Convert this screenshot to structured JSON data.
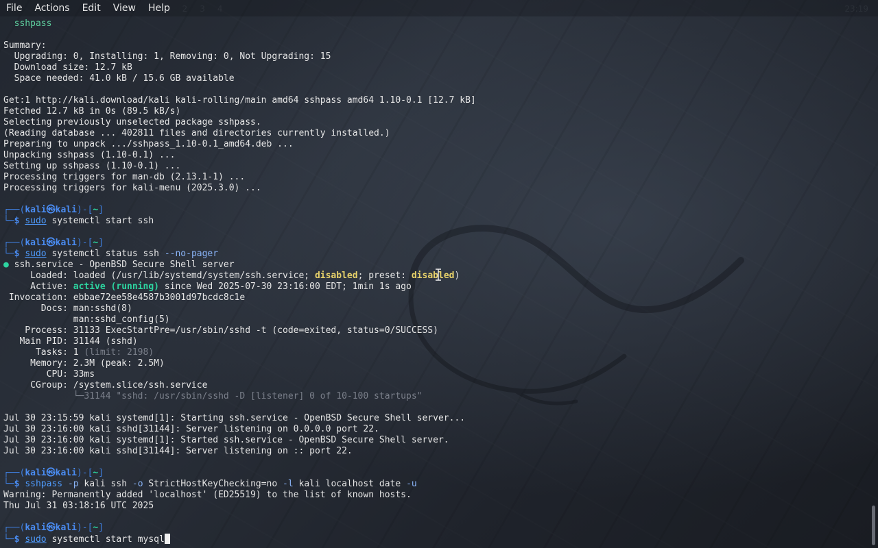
{
  "menubar": {
    "items": [
      "File",
      "Actions",
      "Edit",
      "View",
      "Help"
    ]
  },
  "ghost_panel": {
    "workspaces": [
      "1",
      "2",
      "3",
      "4"
    ],
    "clock": "23:19"
  },
  "terminal": {
    "lines": [
      {
        "segs": [
          {
            "t": "  sshpass",
            "c": "c-green"
          }
        ]
      },
      {
        "segs": [
          {
            "t": ""
          }
        ]
      },
      {
        "segs": [
          {
            "t": "Summary:"
          }
        ]
      },
      {
        "segs": [
          {
            "t": "  Upgrading: 0, Installing: 1, Removing: 0, Not Upgrading: 15"
          }
        ]
      },
      {
        "segs": [
          {
            "t": "  Download size: 12.7 kB"
          }
        ]
      },
      {
        "segs": [
          {
            "t": "  Space needed: 41.0 kB / 15.6 GB available"
          }
        ]
      },
      {
        "segs": [
          {
            "t": ""
          }
        ]
      },
      {
        "segs": [
          {
            "t": "Get:1 http://kali.download/kali kali-rolling/main amd64 sshpass amd64 1.10-0.1 [12.7 kB]"
          }
        ]
      },
      {
        "segs": [
          {
            "t": "Fetched 12.7 kB in 0s (89.5 kB/s)"
          }
        ]
      },
      {
        "segs": [
          {
            "t": "Selecting previously unselected package sshpass."
          }
        ]
      },
      {
        "segs": [
          {
            "t": "(Reading database ... 402811 files and directories currently installed.)"
          }
        ]
      },
      {
        "segs": [
          {
            "t": "Preparing to unpack .../sshpass_1.10-0.1_amd64.deb ..."
          }
        ]
      },
      {
        "segs": [
          {
            "t": "Unpacking sshpass (1.10-0.1) ..."
          }
        ]
      },
      {
        "segs": [
          {
            "t": "Setting up sshpass (1.10-0.1) ..."
          }
        ]
      },
      {
        "segs": [
          {
            "t": "Processing triggers for man-db (2.13.1-1) ..."
          }
        ]
      },
      {
        "segs": [
          {
            "t": "Processing triggers for kali-menu (2025.3.0) ..."
          }
        ]
      },
      {
        "segs": [
          {
            "t": ""
          }
        ]
      },
      {
        "prompt": true,
        "segs": [
          {
            "t": "┌──(",
            "c": "c-blue"
          },
          {
            "t": "kali㉿kali",
            "c": "c-blue-b"
          },
          {
            "t": ")-[",
            "c": "c-blue"
          },
          {
            "t": "~",
            "c": "c-green-b"
          },
          {
            "t": "]",
            "c": "c-blue"
          }
        ]
      },
      {
        "cmd": true,
        "segs": [
          {
            "t": "└─",
            "c": "c-blue"
          },
          {
            "t": "$ ",
            "c": "c-blue-b"
          },
          {
            "t": "sudo",
            "c": "c-cmd-blue",
            "u": true
          },
          {
            "t": " systemctl start ssh"
          }
        ]
      },
      {
        "segs": [
          {
            "t": ""
          }
        ]
      },
      {
        "prompt": true,
        "segs": [
          {
            "t": "┌──(",
            "c": "c-blue"
          },
          {
            "t": "kali㉿kali",
            "c": "c-blue-b"
          },
          {
            "t": ")-[",
            "c": "c-blue"
          },
          {
            "t": "~",
            "c": "c-green-b"
          },
          {
            "t": "]",
            "c": "c-blue"
          }
        ]
      },
      {
        "cmd": true,
        "segs": [
          {
            "t": "└─",
            "c": "c-blue"
          },
          {
            "t": "$ ",
            "c": "c-blue-b"
          },
          {
            "t": "sudo",
            "c": "c-cmd-blue",
            "u": true
          },
          {
            "t": " systemctl status ssh "
          },
          {
            "t": "--no-pager",
            "c": "c-opt"
          }
        ]
      },
      {
        "segs": [
          {
            "t": "●",
            "c": "c-dot"
          },
          {
            "t": " ssh.service - OpenBSD Secure Shell server"
          }
        ]
      },
      {
        "segs": [
          {
            "t": "     Loaded: loaded (/usr/lib/systemd/system/ssh.service; "
          },
          {
            "t": "disabled",
            "c": "c-yellow-b"
          },
          {
            "t": "; preset: "
          },
          {
            "t": "disabled",
            "c": "c-yellow-b"
          },
          {
            "t": ")"
          }
        ]
      },
      {
        "segs": [
          {
            "t": "     Active: "
          },
          {
            "t": "active (running)",
            "c": "c-green-b"
          },
          {
            "t": " since Wed 2025-07-30 23:16:00 EDT; 1min 1s ago"
          }
        ]
      },
      {
        "segs": [
          {
            "t": " Invocation: ebbae72ee58e4587b3001d97bcdc8c1e"
          }
        ]
      },
      {
        "segs": [
          {
            "t": "       Docs: man:sshd(8)"
          }
        ]
      },
      {
        "segs": [
          {
            "t": "             man:sshd_config(5)"
          }
        ]
      },
      {
        "segs": [
          {
            "t": "    Process: 31133 ExecStartPre=/usr/sbin/sshd -t (code=exited, status=0/SUCCESS)"
          }
        ]
      },
      {
        "segs": [
          {
            "t": "   Main PID: 31144 (sshd)"
          }
        ]
      },
      {
        "segs": [
          {
            "t": "      Tasks: 1 "
          },
          {
            "t": "(limit: 2198)",
            "c": "c-dim"
          }
        ]
      },
      {
        "segs": [
          {
            "t": "     Memory: 2.3M (peak: 2.5M)"
          }
        ]
      },
      {
        "segs": [
          {
            "t": "        CPU: 33ms"
          }
        ]
      },
      {
        "segs": [
          {
            "t": "     CGroup: /system.slice/ssh.service"
          }
        ]
      },
      {
        "segs": [
          {
            "t": "             └─31144 \"sshd: /usr/sbin/sshd -D [listener] 0 of 10-100 startups\"",
            "c": "c-dim"
          }
        ]
      },
      {
        "segs": [
          {
            "t": ""
          }
        ]
      },
      {
        "segs": [
          {
            "t": "Jul 30 23:15:59 kali systemd[1]: Starting ssh.service - OpenBSD Secure Shell server..."
          }
        ]
      },
      {
        "segs": [
          {
            "t": "Jul 30 23:16:00 kali sshd[31144]: Server listening on 0.0.0.0 port 22."
          }
        ]
      },
      {
        "segs": [
          {
            "t": "Jul 30 23:16:00 kali systemd[1]: Started ssh.service - OpenBSD Secure Shell server."
          }
        ]
      },
      {
        "segs": [
          {
            "t": "Jul 30 23:16:00 kali sshd[31144]: Server listening on :: port 22."
          }
        ]
      },
      {
        "segs": [
          {
            "t": ""
          }
        ]
      },
      {
        "prompt": true,
        "segs": [
          {
            "t": "┌──(",
            "c": "c-blue"
          },
          {
            "t": "kali㉿kali",
            "c": "c-blue-b"
          },
          {
            "t": ")-[",
            "c": "c-blue"
          },
          {
            "t": "~",
            "c": "c-green-b"
          },
          {
            "t": "]",
            "c": "c-blue"
          }
        ]
      },
      {
        "cmd": true,
        "segs": [
          {
            "t": "└─",
            "c": "c-blue"
          },
          {
            "t": "$ ",
            "c": "c-blue-b"
          },
          {
            "t": "sshpass",
            "c": "c-cmd-blue"
          },
          {
            "t": " "
          },
          {
            "t": "-p",
            "c": "c-opt"
          },
          {
            "t": " kali ssh "
          },
          {
            "t": "-o",
            "c": "c-opt"
          },
          {
            "t": " StrictHostKeyChecking=no "
          },
          {
            "t": "-l",
            "c": "c-opt"
          },
          {
            "t": " kali localhost date "
          },
          {
            "t": "-u",
            "c": "c-opt"
          }
        ]
      },
      {
        "segs": [
          {
            "t": "Warning: Permanently added 'localhost' (ED25519) to the list of known hosts."
          }
        ]
      },
      {
        "segs": [
          {
            "t": "Thu Jul 31 03:18:16 UTC 2025"
          }
        ]
      },
      {
        "segs": [
          {
            "t": ""
          }
        ]
      },
      {
        "prompt": true,
        "segs": [
          {
            "t": "┌──(",
            "c": "c-blue"
          },
          {
            "t": "kali㉿kali",
            "c": "c-blue-b"
          },
          {
            "t": ")-[",
            "c": "c-blue"
          },
          {
            "t": "~",
            "c": "c-green-b"
          },
          {
            "t": "]",
            "c": "c-blue"
          }
        ]
      },
      {
        "cmd": true,
        "current": true,
        "segs": [
          {
            "t": "└─",
            "c": "c-blue"
          },
          {
            "t": "$ ",
            "c": "c-blue-b"
          },
          {
            "t": "sudo",
            "c": "c-cmd-blue",
            "u": true
          },
          {
            "t": " systemctl start mysql"
          }
        ]
      }
    ]
  },
  "colors": {
    "prompt_blue": "#3f7fe0",
    "path_green": "#2dd4a0",
    "warning_yellow": "#e8d26a"
  },
  "icons": [
    "kali-dragon-icon",
    "text-cursor-icon",
    "terminal-cursor-icon"
  ]
}
